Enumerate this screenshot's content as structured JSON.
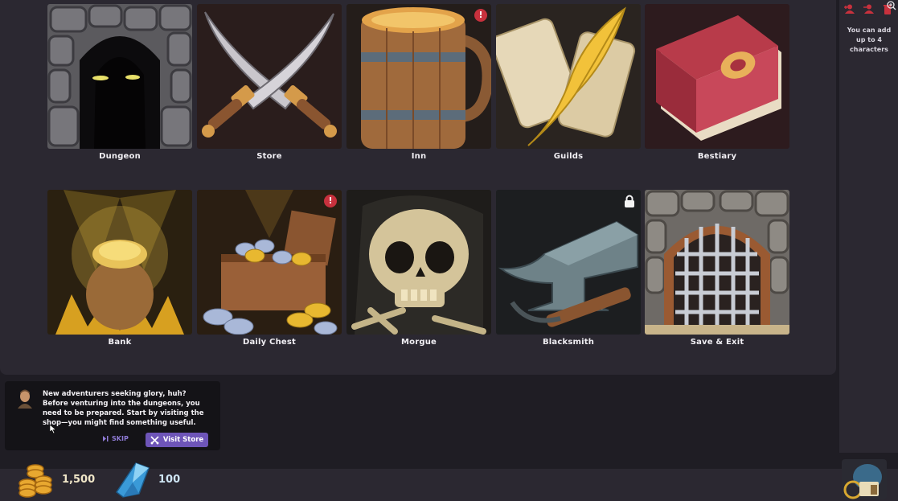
{
  "tiles": [
    {
      "id": "dungeon",
      "label": "Dungeon"
    },
    {
      "id": "store",
      "label": "Store"
    },
    {
      "id": "inn",
      "label": "Inn",
      "badge": "!"
    },
    {
      "id": "guilds",
      "label": "Guilds"
    },
    {
      "id": "bestiary",
      "label": "Bestiary"
    },
    {
      "id": "bank",
      "label": "Bank"
    },
    {
      "id": "daily-chest",
      "label": "Daily Chest",
      "badge": "!"
    },
    {
      "id": "morgue",
      "label": "Morgue"
    },
    {
      "id": "blacksmith",
      "label": "Blacksmith",
      "locked": true
    },
    {
      "id": "save-exit",
      "label": "Save & Exit"
    }
  ],
  "badges": {
    "inn": "!",
    "daily_chest": "!"
  },
  "sidebar": {
    "note": "You can add up to 4 characters"
  },
  "dialog": {
    "text": "New adventurers seeking glory, huh? Before venturing into the dungeons, you need to be prepared. Start by visiting the shop—you might find something useful.",
    "skip_label": "SKIP",
    "visit_label": "Visit Store"
  },
  "currency": {
    "gold": "1,500",
    "gems": "100"
  },
  "colors": {
    "accent": "#6e55b8",
    "badge": "#c8313d",
    "panel": "#2b2831",
    "background": "#1f1d24"
  }
}
